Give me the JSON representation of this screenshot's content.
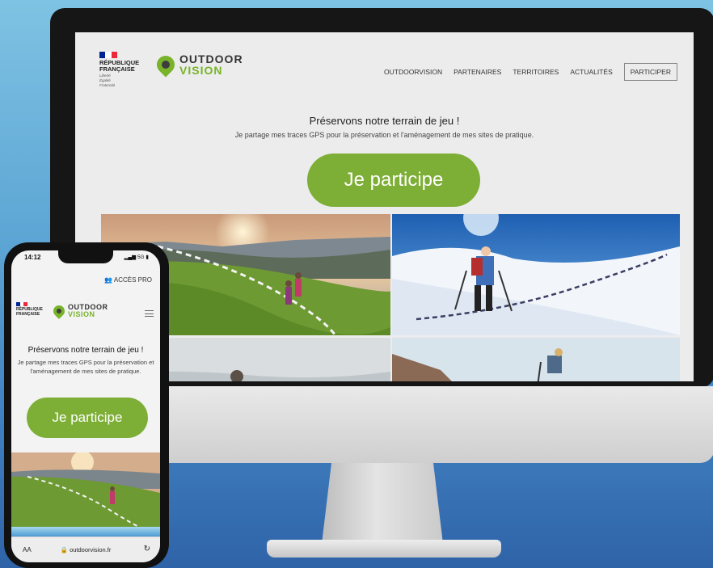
{
  "desktop": {
    "republique": [
      "RÉPUBLIQUE",
      "FRANÇAISE"
    ],
    "motto": [
      "Liberté",
      "Égalité",
      "Fraternité"
    ],
    "logo": {
      "word1": "OUTDOOR",
      "word2": "VISION"
    },
    "nav": [
      "OUTDOORVISION",
      "PARTENAIRES",
      "TERRITOIRES",
      "ACTUALITÉS"
    ],
    "nav_cta": "PARTICIPER",
    "tagline_title": "Préservons notre terrain de jeu !",
    "tagline_sub": "Je partage mes traces GPS pour la préservation et l'aménagement de mes sites de pratique.",
    "cta_button": "Je participe"
  },
  "phone": {
    "time": "14:12",
    "signal": "5G",
    "acces_pro": "ACCÈS PRO",
    "republique": [
      "RÉPUBLIQUE",
      "FRANÇAISE"
    ],
    "logo": {
      "word1": "OUTDOOR",
      "word2": "VISION"
    },
    "tagline_title": "Préservons notre terrain de jeu !",
    "tagline_sub": "Je partage mes traces GPS pour la préservation et l'aménagement de mes sites de pratique.",
    "cta_button": "Je participe",
    "url_aa": "AA",
    "url": "outdoorvision.fr"
  },
  "colors": {
    "brand_green": "#7dae35",
    "logo_green": "#78b32a",
    "flag": [
      "#002395",
      "#ffffff",
      "#ed2939"
    ]
  },
  "icons": [
    "flag-icon",
    "map-pin-logo-icon",
    "hamburger-menu-icon",
    "reload-icon",
    "user-icon"
  ]
}
